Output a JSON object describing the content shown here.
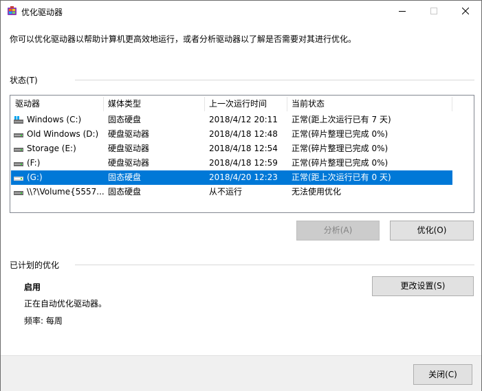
{
  "window": {
    "title": "优化驱动器",
    "controls": {
      "minimize": "minimize",
      "maximize": "maximize",
      "close": "close"
    }
  },
  "intro": "你可以优化驱动器以帮助计算机更高效地运行，或者分析驱动器以了解是否需要对其进行优化。",
  "status_section": {
    "label": "状态(T)",
    "columns": [
      "驱动器",
      "媒体类型",
      "上一次运行时间",
      "当前状态"
    ],
    "rows": [
      {
        "drive": "Windows (C:)",
        "media": "固态硬盘",
        "last_run": "2018/4/12 20:11",
        "status": "正常(距上次运行已有 7 天)",
        "icon": "windows-drive-icon",
        "selected": false
      },
      {
        "drive": "Old Windows (D:)",
        "media": "硬盘驱动器",
        "last_run": "2018/4/18 12:48",
        "status": "正常(碎片整理已完成 0%)",
        "icon": "hard-drive-icon",
        "selected": false
      },
      {
        "drive": "Storage (E:)",
        "media": "硬盘驱动器",
        "last_run": "2018/4/18 12:54",
        "status": "正常(碎片整理已完成 0%)",
        "icon": "hard-drive-icon",
        "selected": false
      },
      {
        "drive": "(F:)",
        "media": "硬盘驱动器",
        "last_run": "2018/4/18 12:59",
        "status": "正常(碎片整理已完成 0%)",
        "icon": "hard-drive-icon",
        "selected": false
      },
      {
        "drive": "(G:)",
        "media": "固态硬盘",
        "last_run": "2018/4/20 12:23",
        "status": "正常(距上次运行已有 0 天)",
        "icon": "hard-drive-icon",
        "selected": true
      },
      {
        "drive": "\\\\?\\Volume{5557...",
        "media": "固态硬盘",
        "last_run": "从不运行",
        "status": "无法使用优化",
        "icon": "hard-drive-icon",
        "selected": false
      }
    ],
    "analyze_button": "分析(A)",
    "optimize_button": "优化(O)"
  },
  "schedule_section": {
    "label": "已计划的优化",
    "state": "启用",
    "description": "正在自动优化驱动器。",
    "frequency": "频率: 每周",
    "change_settings_button": "更改设置(S)"
  },
  "footer": {
    "close_button": "关闭(C)"
  },
  "colors": {
    "selection": "#0078d7",
    "button_bg": "#e1e1e1",
    "footer_bg": "#f0f0f0"
  }
}
